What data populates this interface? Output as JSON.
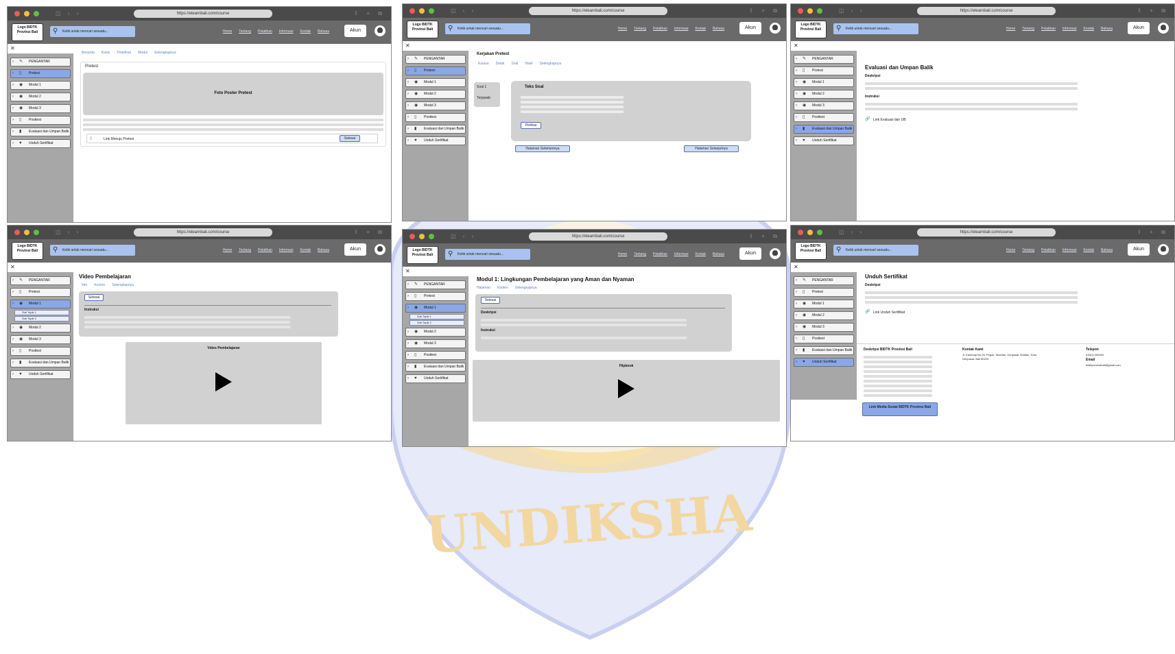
{
  "watermark": {
    "text": "UNDIKSHA",
    "color": "#f3c35a",
    "accent": "#c9cff0"
  },
  "common": {
    "logo": "Logo BIDTK Provinsi Bali",
    "search_placeholder": "Ketik untuk mencari sesuatu...",
    "nav": [
      "Home",
      "Tentang",
      "Pelatihan",
      "Informasi",
      "Kontak",
      "Bahasa"
    ],
    "account": "Akun",
    "sidebar": {
      "pengantar": "PENGANTAR",
      "pretest": "Pretest",
      "modul1": "Modul 1",
      "modul2": "Modul 2",
      "modul3": "Modul 3",
      "posttest": "Posttest",
      "evaluasi": "Evaluasi dan Umpan Balik",
      "sertifikat": "Unduh Sertifikat",
      "sub1": "Sub Topik 1",
      "sub2": "Sub Topik 2"
    }
  },
  "win1": {
    "url": "https://elearnbali.com/course",
    "crumbs": [
      "Beranda",
      "Kelas",
      "Pelatihan",
      "Modul",
      "Selengkapnya"
    ],
    "title": "Pretest",
    "poster": "Foto Poster Pretest",
    "link": "Link Menuju Pretest",
    "button": "Selesai"
  },
  "win2": {
    "url": "https://elearnbali.com/course",
    "title": "Kerjakan Pretest",
    "crumbs": [
      "Kursus",
      "Detail",
      "Soal",
      "Hasil",
      "Selengkapnya"
    ],
    "soal": [
      "Soal 1",
      "Terjawab"
    ],
    "question": "Teks Soal",
    "check_button": "Periksa",
    "prev_button": "Halaman Sebelumnya",
    "next_button": "Halaman Selanjutnya"
  },
  "win3": {
    "url": "https://elearnbali.com/course",
    "title": "Evaluasi dan Umpan Balik",
    "deskripsi": "Deskripsi",
    "instruksi": "Instruksi",
    "link": "Link Evaluasi dan UB"
  },
  "win4": {
    "url": "https://elearnbali.com/course",
    "title": "Video Pembelajaran",
    "crumbs": [
      "Info",
      "Konten",
      "Selengkapnya"
    ],
    "button": "Selesai",
    "instruksi": "Instruksi",
    "video_title": "Video Pembelajaran"
  },
  "win5": {
    "url": "https://elearnbali.com/course",
    "title": "Modul 1: Lingkungan Pembelajaran yang Aman dan Nyaman",
    "crumbs": [
      "Halaman",
      "Konten",
      "Selengkapnya"
    ],
    "button": "Selesai",
    "deskripsi": "Deskripsi",
    "instruksi": "Instruksi",
    "flipbook": "Flipbook"
  },
  "win6": {
    "url": "https://elearnbali.com/course",
    "title": "Unduh Sertifikat",
    "deskripsi": "Deskripsi",
    "link": "Link Unduh Sertifikat",
    "footer_about": "Deskripsi BIDTK Provinsi Bali",
    "contact_title": "Kontak Kami",
    "contact_address": "Jl. Kamboja No.25, Pegok, Sesetan, Denpasar Selatan, Kota Denpasar, Bali 80223",
    "phone_title": "Telepon",
    "phone": "(0361) 000000",
    "email_title": "Email",
    "email": "bidtkprovinsibali@gmail.com",
    "social_button": "Link Media Sosial BIDTK Provinsi Bali"
  }
}
